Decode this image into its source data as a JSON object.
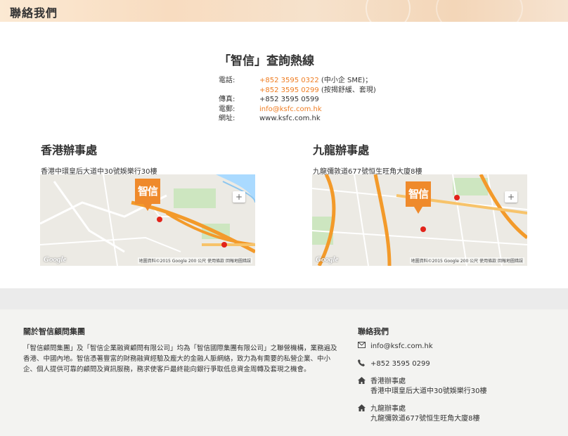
{
  "header": {
    "title": "聯絡我們"
  },
  "hotline": {
    "title": "「智信」查詢熱線",
    "rows": [
      {
        "label": "電話:",
        "value_orange": "+852 3595 0322",
        "value_suffix": " (中小企 SME)；"
      },
      {
        "label": "",
        "value_orange": "+852 3595 0299",
        "value_suffix": " (按揭舒緩、套現)"
      },
      {
        "label": "傳真:",
        "value_orange": "",
        "value_suffix": "+852 3595 0599"
      },
      {
        "label": "電郵:",
        "value_orange": "info@ksfc.com.hk",
        "value_suffix": ""
      },
      {
        "label": "網址:",
        "value_orange": "",
        "value_suffix": "www.ksfc.com.hk"
      }
    ]
  },
  "offices": {
    "hk": {
      "title": "香港辦事處",
      "address": "香港中環皇后大道中30號娛樂行30樓"
    },
    "kln": {
      "title": "九龍辦事處",
      "address": "九龍彌敦道677號恒生旺角大廈8樓"
    }
  },
  "map": {
    "logo_text": "智信",
    "google": "Google",
    "footer_text": "地圖資料©2015 Google  200 公尺  使用條款  回報地圖錯誤",
    "zoom_plus": "+"
  },
  "footer": {
    "about_title": "關於智信顧問集團",
    "about_text": "「智信顧問集團」及「智信企業融資顧問有限公司」均為「智信國際集團有限公司」之聯營機構，業務遍及香港、中國內地。智信憑著豐富的財務融資經驗及龐大的金融人脈網絡，致力為有需要的私營企業、中小企、個人提供可靠的顧問及資訊服務，務求使客戶最終能向銀行爭取低息資金周轉及套現之機會。",
    "contact_title": "聯絡我們",
    "email": "info@ksfc.com.hk",
    "phone": "+852 3595 0299",
    "hk_label": "香港辦事處",
    "hk_address": "香港中環皇后大道中30號娛樂行30樓",
    "kln_label": "九龍辦事處",
    "kln_address": "九龍彌敦道677號恒生旺角大廈8樓"
  },
  "icons": {
    "email": "envelope-icon",
    "phone": "phone-icon",
    "home": "home-icon"
  },
  "colors": {
    "accent": "#ef7d22",
    "footer_bg": "#f3f3f1"
  }
}
